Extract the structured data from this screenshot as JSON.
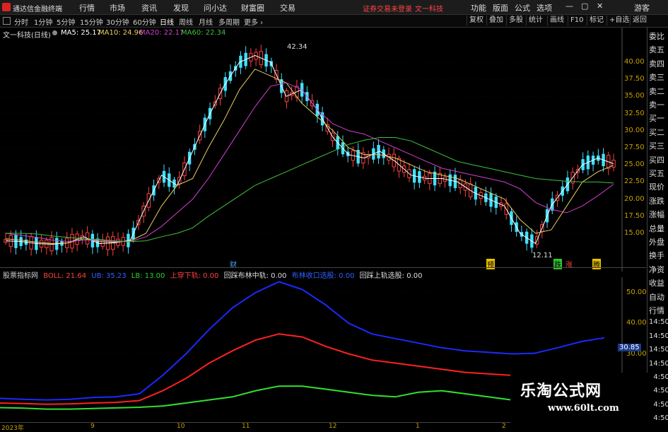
{
  "app": {
    "name": "通达信金融终端"
  },
  "menu": [
    "行情",
    "市场",
    "资讯",
    "发现",
    "问小达",
    "财富圈",
    "交易"
  ],
  "menu_notice": "证券交易未登录",
  "stock_title": "文一科技",
  "right_menu": [
    "功能",
    "版面",
    "公式",
    "选项"
  ],
  "guest": "游客",
  "periods": [
    "分时",
    "1分钟",
    "5分钟",
    "15分钟",
    "30分钟",
    "60分钟",
    "日线",
    "周线",
    "月线",
    "多周期",
    "更多 ›"
  ],
  "active_period": "日线",
  "tools": [
    "复权",
    "叠加",
    "多股",
    "统计",
    "画线",
    "F10",
    "标记",
    "+自选",
    "返回"
  ],
  "chart_title": "文一科技(日线)",
  "ma": [
    {
      "label": "MA5: 25.17",
      "color": "#ffffff"
    },
    {
      "label": "MA10: 24.96",
      "color": "#e8d060"
    },
    {
      "label": "MA20: 22.17",
      "color": "#d040d0"
    },
    {
      "label": "MA60: 22.34",
      "color": "#40c040"
    }
  ],
  "y_labels": [
    "40.00",
    "37.50",
    "35.00",
    "32.50",
    "30.00",
    "27.50",
    "25.00",
    "22.50",
    "20.00",
    "17.50",
    "15.00"
  ],
  "price_max": "42.34",
  "price_min": "12.11",
  "markers": [
    "财",
    "预",
    "跌",
    "涨",
    "腾"
  ],
  "right_panel": [
    "委比",
    "卖五",
    "卖四",
    "卖三",
    "卖二",
    "卖一",
    "买一",
    "买二",
    "买三",
    "买四",
    "买五",
    "现价",
    "涨跌",
    "涨幅",
    "总量",
    "外盘",
    "换手",
    "净资",
    "收益",
    "自动",
    "行情",
    "14:50",
    "14:50",
    "14:50",
    "14:50",
    "14:50",
    "14:50",
    "14:50",
    "14:50"
  ],
  "sub": {
    "name": "股票指标网",
    "boll": "BOLL: 21.64",
    "ub": "UB: 35.23",
    "lb": "LB: 13.00",
    "s1": "上穿下轨: 0.00",
    "s2": "回踩布林中轨: 0.00",
    "s3": "布林收口选股: 0.00",
    "s4": "回踩上轨选股: 0.00",
    "y_labels": [
      "50.00",
      "40.00",
      "30.00"
    ],
    "cur": "30.85"
  },
  "x_labels": [
    "2023年",
    "9",
    "10",
    "11",
    "12",
    "1",
    "2"
  ],
  "watermark": {
    "title": "乐淘公式网",
    "url": "www.60lt.com"
  },
  "chart_data": [
    {
      "type": "line",
      "title": "文一科技(日线)",
      "ylim": [
        12,
        43
      ],
      "y_ticks": [
        15,
        17.5,
        20,
        22.5,
        25,
        27.5,
        30,
        32.5,
        35,
        37.5,
        40
      ],
      "series": [
        {
          "name": "MA5",
          "values": [
            13.9,
            13.8,
            13.5,
            13.4,
            13.6,
            14.5,
            13.5,
            13.6,
            14.0,
            19.0,
            23.5,
            22.0,
            27.0,
            32.0,
            36.5,
            40.0,
            41.0,
            40.0,
            35.0,
            36.0,
            33.0,
            29.0,
            26.5,
            26.0,
            27.0,
            25.5,
            23.5,
            23.0,
            23.0,
            22.5,
            21.0,
            20.0,
            19.0,
            15.0,
            13.5,
            19.0,
            22.0,
            25.0,
            26.0,
            25.17
          ]
        },
        {
          "name": "MA10",
          "values": [
            14.2,
            14.0,
            13.7,
            13.5,
            13.6,
            14.2,
            13.8,
            13.7,
            13.9,
            15.0,
            19.0,
            22.0,
            23.0,
            27.5,
            31.5,
            36.0,
            39.0,
            38.0,
            37.0,
            34.0,
            32.0,
            30.0,
            27.5,
            26.5,
            26.5,
            26.0,
            25.0,
            24.0,
            23.5,
            23.0,
            22.0,
            21.0,
            20.0,
            17.0,
            15.0,
            15.5,
            19.0,
            22.5,
            24.0,
            24.96
          ]
        },
        {
          "name": "MA20",
          "values": [
            15.0,
            14.7,
            14.4,
            14.0,
            13.8,
            14.0,
            14.0,
            13.8,
            13.8,
            14.5,
            16.0,
            18.0,
            20.0,
            23.0,
            26.5,
            30.0,
            33.5,
            36.5,
            37.0,
            36.0,
            33.0,
            31.0,
            30.0,
            29.5,
            28.5,
            27.5,
            26.5,
            25.5,
            24.5,
            24.0,
            23.5,
            23.0,
            22.5,
            21.5,
            19.5,
            18.5,
            18.0,
            19.0,
            20.5,
            22.17
          ]
        },
        {
          "name": "MA60",
          "values": [
            15.0,
            15.0,
            14.9,
            14.6,
            14.4,
            14.2,
            14.1,
            13.9,
            13.8,
            13.9,
            14.5,
            15.0,
            15.8,
            17.5,
            19.0,
            20.5,
            22.0,
            23.0,
            24.0,
            25.0,
            26.0,
            27.0,
            28.0,
            28.6,
            29.0,
            29.0,
            28.5,
            27.5,
            26.5,
            25.5,
            25.0,
            24.5,
            24.0,
            23.5,
            23.0,
            22.8,
            22.6,
            22.5,
            22.5,
            22.34
          ]
        }
      ]
    },
    {
      "type": "line",
      "title": "BOLL",
      "ylim": [
        8,
        55
      ],
      "y_ticks": [
        30,
        40,
        50
      ],
      "series": [
        {
          "name": "UB",
          "values": [
            15.5,
            15.2,
            15.0,
            15.2,
            15.8,
            16.0,
            17.0,
            23.0,
            30.0,
            38.0,
            45.0,
            50.0,
            53.5,
            51.0,
            46.0,
            40.0,
            36.5,
            35.0,
            33.5,
            32.0,
            31.0,
            30.5,
            30.0,
            30.2,
            32.0,
            34.0,
            35.23
          ]
        },
        {
          "name": "BOLL",
          "values": [
            14.0,
            13.8,
            13.6,
            13.7,
            14.0,
            14.2,
            14.8,
            18.0,
            22.0,
            27.0,
            31.0,
            34.5,
            36.5,
            35.5,
            32.5,
            30.0,
            28.0,
            27.0,
            26.0,
            25.0,
            24.0,
            23.5,
            23.0,
            22.5,
            22.0,
            21.8,
            21.64
          ]
        },
        {
          "name": "LB",
          "values": [
            12.5,
            12.3,
            12.0,
            12.0,
            12.2,
            12.4,
            12.6,
            13.0,
            14.0,
            15.0,
            16.0,
            18.0,
            19.5,
            19.5,
            18.5,
            17.5,
            16.5,
            16.0,
            17.5,
            18.0,
            17.0,
            16.0,
            15.0,
            14.0,
            13.5,
            13.2,
            13.0
          ]
        }
      ]
    }
  ]
}
